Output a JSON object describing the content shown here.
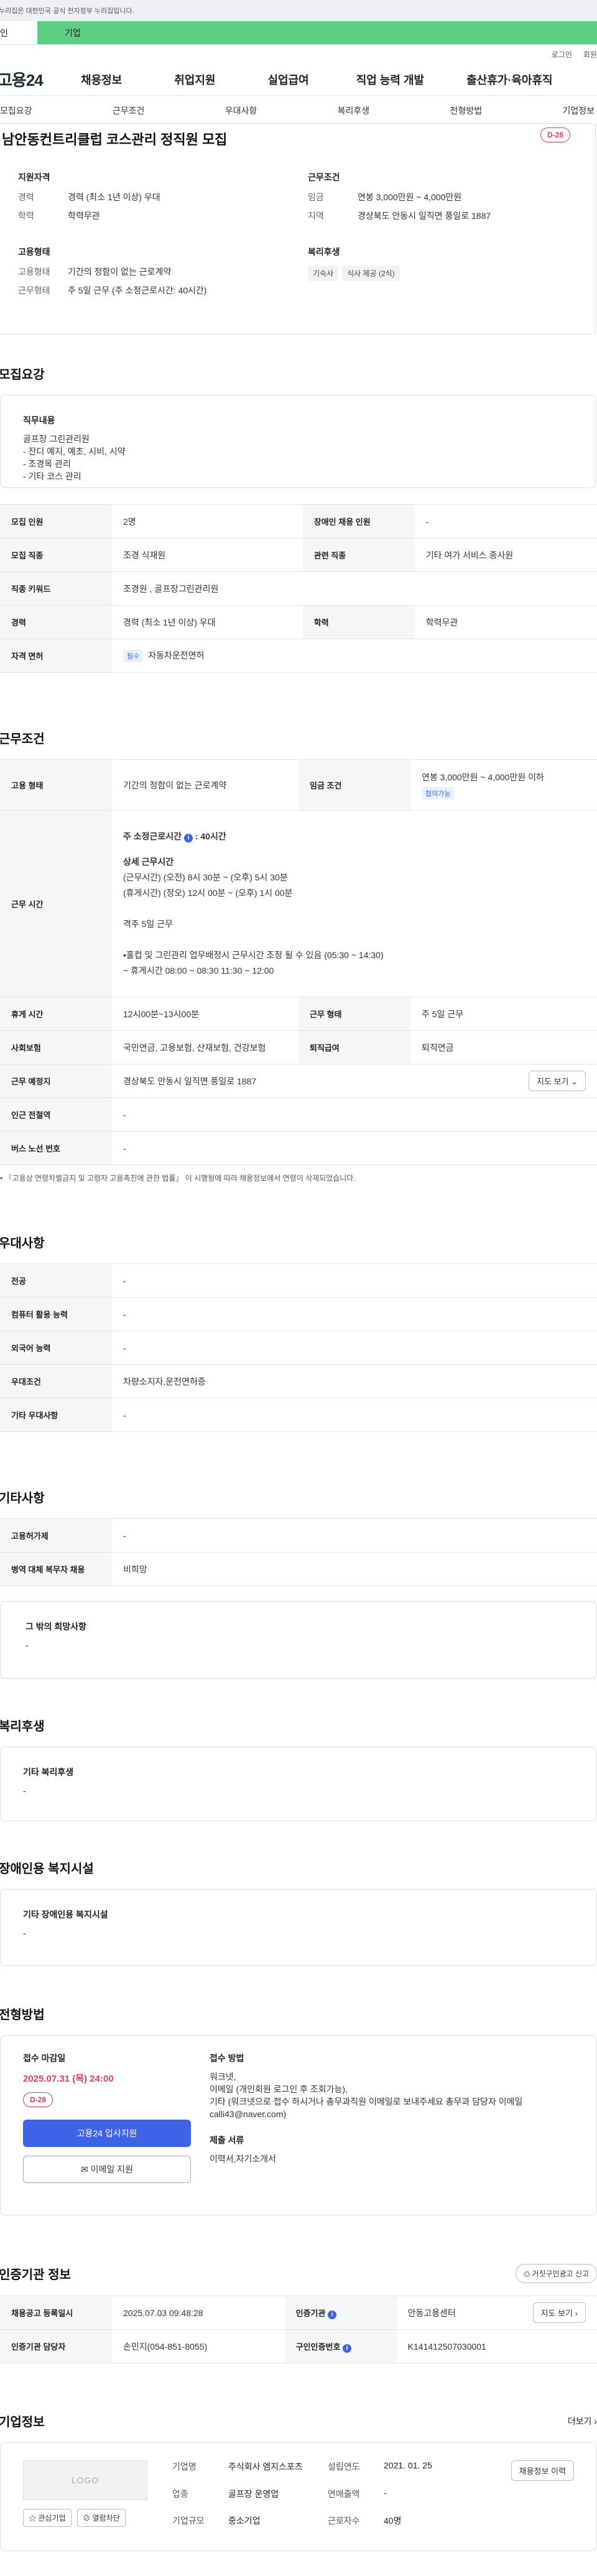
{
  "top_notice": "누리집은 대한민국 공식 전자정부 누리집입니다.",
  "user_tabs": {
    "personal": "인",
    "company": "기업"
  },
  "header_links": {
    "login": "로그인",
    "join": "회원"
  },
  "logo": "고용24",
  "gnb": [
    "채용정보",
    "취업지원",
    "실업급여",
    "직업 능력 개발",
    "출산휴가·육아휴직"
  ],
  "subnav": [
    "모집요강",
    "근무조건",
    "우대사항",
    "복리후생",
    "전형방법",
    "기업정보"
  ],
  "job": {
    "title": "남안동컨트리클럽 코스관리 정직원 모집",
    "dday": "D-28",
    "qual_title": "지원자격",
    "qual": [
      {
        "k": "경력",
        "v": "경력 (최소 1년 이상) 우대"
      },
      {
        "k": "학력",
        "v": "학력무관"
      }
    ],
    "cond_title": "근무조건",
    "cond": [
      {
        "k": "임금",
        "v": "연봉 3,000만원 ~ 4,000만원"
      },
      {
        "k": "지역",
        "v": "경상북도 안동시 일직면 풍일로 1887"
      }
    ],
    "emp_title": "고용형태",
    "emp": [
      {
        "k": "고용형태",
        "v": "기간의 정함이 없는 근로계약"
      },
      {
        "k": "근무형태",
        "v": "주 5일 근무 (주 소정근로시간: 40시간)"
      }
    ],
    "welfare_title": "복리후생",
    "welfare_chips": [
      "기숙사",
      "식사 제공 (2식)"
    ]
  },
  "recruit": {
    "heading": "모집요강",
    "duty_title": "직무내용",
    "duty_text": "골프장 그린관리원\n- 잔디 예지, 예초, 시비, 시약\n- 조경목 관리\n- 기타 코스 관리",
    "rows": [
      {
        "k1": "모집 인원",
        "v1": "2명",
        "k2": "장애인 채용 인원",
        "v2": "-"
      },
      {
        "k1": "모집 직종",
        "v1": "조경 식재원",
        "k2": "관련 직종",
        "v2": "기타 여가 서비스 종사원"
      },
      {
        "k1": "직종 키워드",
        "v1": "조경원 , 골프장그린관리원"
      },
      {
        "k1": "경력",
        "v1": "경력 (최소 1년 이상) 우대",
        "k2": "학력",
        "v2": "학력무관"
      },
      {
        "k1": "자격 면허",
        "tag": "필수",
        "v1": "자동차운전면허"
      }
    ]
  },
  "work": {
    "heading": "근무조건",
    "emp_type_k": "고용 형태",
    "emp_type_v": "기간의 정함이 없는 근로계약",
    "wage_k": "임금 조건",
    "wage_v": "연봉 3,000만원 ~ 4,000만원 이하",
    "wage_tag": "협의가능",
    "hours_k": "근무 시간",
    "hours_main": "주 소정근로시간",
    "hours_main_value": "40시간",
    "hours_detail_title": "상세 근무시간",
    "hours_lines": [
      "(근무시간) (오전) 8시 30분 ~ (오후) 5시 30분",
      "(휴게시간) (정오) 12시 00분 ~ (오후) 1시 00분",
      "",
      "격주 5일 근무",
      "",
      "•홀컵 및 그린관리 업무배정시 근무시간 조정 될 수 있음 (05:30 ~ 14:30)",
      "~ 휴게시간 08:00 ~ 08:30     11:30 ~ 12:00"
    ],
    "rows": [
      {
        "k1": "휴게 시간",
        "v1": "12시00분~13시00분",
        "k2": "근무 형태",
        "v2": "주 5일 근무"
      },
      {
        "k1": "사회보험",
        "v1": "국민연금, 고용보험, 산재보험, 건강보험",
        "k2": "퇴직급여",
        "v2": "퇴직연금"
      },
      {
        "k1": "근무 예정지",
        "v1": "경상북도 안동시 일직면 풍일로 1887",
        "btn": "지도 보기"
      },
      {
        "k1": "인근 전철역",
        "v1": "-"
      },
      {
        "k1": "버스 노선 번호",
        "v1": "-"
      }
    ],
    "note": "• 『고용상 연령차별금지 및 고령자 고용촉진에 관한 법률』 이 시행됨에 따라 채용정보에서 연령이 삭제되었습니다."
  },
  "pref": {
    "heading": "우대사항",
    "rows": [
      {
        "k": "전공",
        "v": "-"
      },
      {
        "k": "컴퓨터 활용 능력",
        "v": "-"
      },
      {
        "k": "외국어 능력",
        "v": "-"
      },
      {
        "k": "우대조건",
        "v": "차량소지자,운전면허증"
      },
      {
        "k": "기타 우대사항",
        "v": "-"
      }
    ]
  },
  "etc": {
    "heading": "기타사항",
    "rows": [
      {
        "k": "고용허가제",
        "v": "-"
      },
      {
        "k": "병역 대체 복무자 채용",
        "v": "비희망"
      }
    ],
    "other_title": "그 밖의 희망사항",
    "other_text": "-"
  },
  "benefit": {
    "heading": "복리후생",
    "title": "기타 복리후생",
    "text": "-"
  },
  "disabled": {
    "heading": "장애인용 복지시설",
    "title": "기타 장애인용 복지시설",
    "text": "-"
  },
  "apply": {
    "heading": "전형방법",
    "deadline_title": "접수 마감일",
    "deadline": "2025.07.31 (목) 24:00",
    "dday": "D-28",
    "btn_primary": "고용24 입사지원",
    "btn_email": "이메일 지원",
    "method_title": "접수 방법",
    "method_text": "워크넷,\n이메일 (개인회원 로그인 후 조회가능),\n기타 (워크넷으로 접수 하시거나 총무과직원 이메일로 보내주세요   총무과 담당자 이메일  calli43@naver.com)",
    "docs_title": "제출 서류",
    "docs_text": "이력서,자기소개서"
  },
  "cert": {
    "heading": "인증기관 정보",
    "report_btn": "거짓구인광고 신고",
    "rows": [
      {
        "k1": "채용공고 등록일시",
        "v1": "2025.07.03 09:48:28",
        "k2": "인증기관",
        "v2": "안동고용센터",
        "btn": "지도 보기"
      },
      {
        "k1": "인증기관 담당자",
        "v1": "손민지(054-851-8055)",
        "k2": "구인인증번호",
        "v2": "K141412507030001"
      }
    ]
  },
  "company": {
    "heading": "기업정보",
    "more": "더보기",
    "logo_text": "LOGO",
    "btn_interest": "관심기업",
    "btn_block": "열람차단",
    "fields": [
      {
        "k": "기업명",
        "v": "주식회사 엠지스포츠"
      },
      {
        "k": "설립연도",
        "v": "2021. 01. 25"
      },
      {
        "k": "업종",
        "v": "골프장 운영업"
      },
      {
        "k": "연매출액",
        "v": "-"
      },
      {
        "k": "기업규모",
        "v": "중소기업"
      },
      {
        "k": "근로자수",
        "v": "40명"
      }
    ],
    "btn_jobs": "채용정보 이력"
  }
}
